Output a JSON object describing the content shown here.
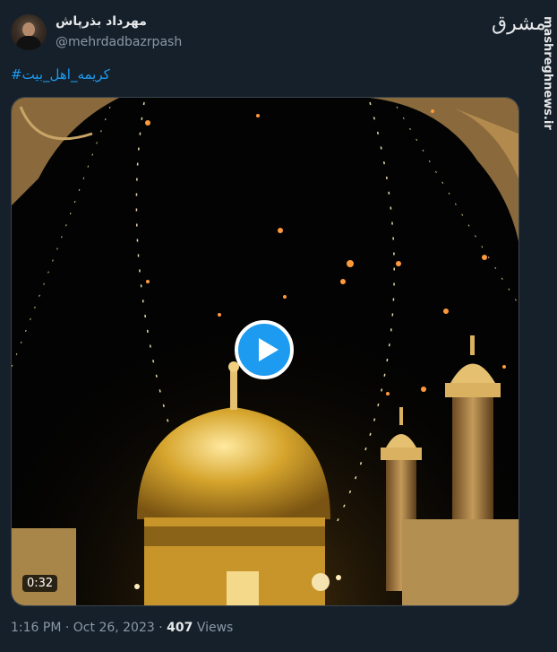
{
  "tweet": {
    "display_name": "مهرداد بذرپاش",
    "handle": "@mehrdadbazrpash",
    "hashtag": "#کریمه_اهل_بیت",
    "video_duration": "0:32",
    "time": "1:16 PM",
    "separator": "·",
    "date": "Oct 26, 2023",
    "dot": "·",
    "views_count": "407",
    "views_label": "Views"
  },
  "watermark": {
    "logo": "مشرق",
    "site": "mashreghnews.ir"
  },
  "colors": {
    "background": "#15202b",
    "accent": "#1d9bf0",
    "secondary_text": "#8b98a5",
    "dome_gold": "#d6a52d"
  },
  "icons": {
    "play": "play-icon"
  }
}
